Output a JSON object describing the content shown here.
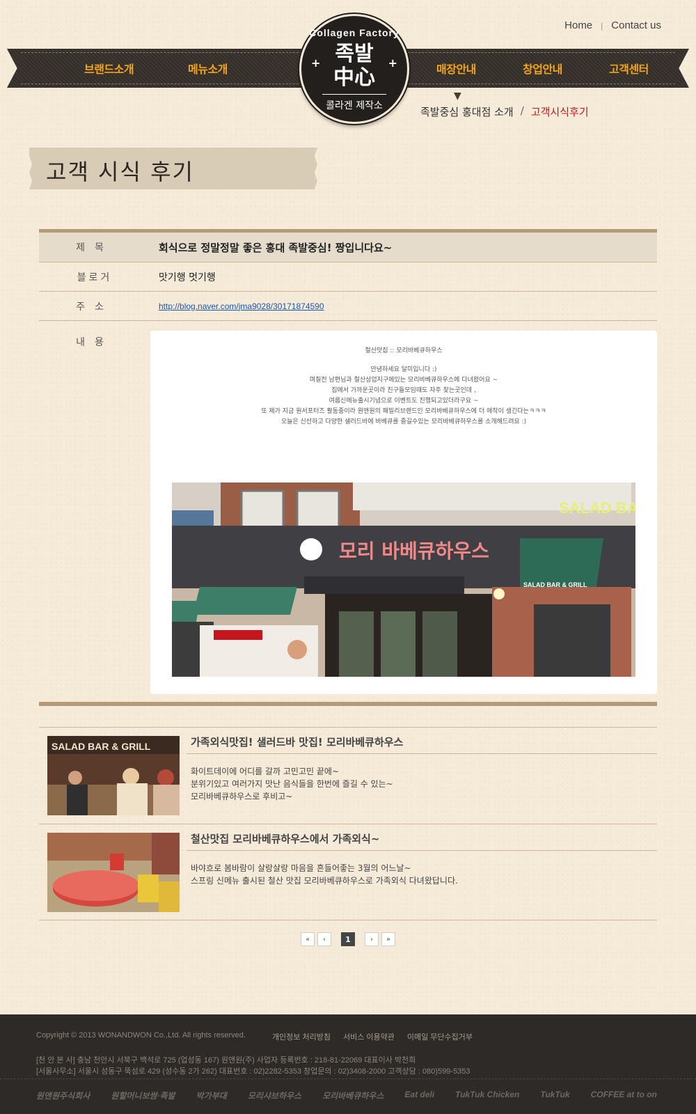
{
  "top_links": {
    "home": "Home",
    "contact": "Contact us"
  },
  "nav": [
    "브랜드소개",
    "메뉴소개",
    "매장안내",
    "창업안내",
    "고객센터"
  ],
  "logo": {
    "top": "Collagen Factory",
    "main_line1": "족발",
    "main_line2": "中心",
    "sub": "콜라겐 제작소"
  },
  "breadcrumb": {
    "parent": "족발중심 홍대점 소개",
    "sep": "/",
    "current": "고객시식후기"
  },
  "page_title": "고객 시식 후기",
  "detail": {
    "title_label": "제목",
    "title": "회식으로 정말정말 좋은 홍대 족발중심! 짱입니다요~",
    "blogger_label": "블로거",
    "blogger": "맛기행 멋기행",
    "address_label": "주소",
    "address": "http://blog.naver.com/jma9028/30171874590",
    "content_label": "내용",
    "content_heading": "철산맛집 :: 모리바베큐하우스",
    "content_lines": [
      "안녕하세요 달미입니다 :)",
      "며칠전 남편님과 철산상업지구에있는 모리바베큐하우스에 다녀왔어요 ~",
      "집에서 가까운곳이라 친구들모임때도 자주 찾는곳인데 ,",
      "여름신메뉴출시기념으로 이벤트도 진행되고있더라구요 ~",
      "또 제가 지금 원서포터즈 활동중이라 원앤원의 패밀리브랜드인 모리바베큐하우스에 더 애착이 생긴다는ㅋㅋㅋ",
      "오늘은 신선하고 다양한 샐러드바에 바베큐를 즐길수있는 모리바베큐하우스를 소개해드려요 :)"
    ],
    "photo": {
      "sign_korean": "모리 바베큐하우스",
      "salad_bar": "SALAD BA",
      "awning": "SALAD BAR & GRILL"
    }
  },
  "related": [
    {
      "title": "가족외식맛집! 샐러드바 맛집! 모리바베큐하우스",
      "thumb_sign": "SALAD BAR & GRILL",
      "desc": [
        "화이트데이에 어디를 갈까 고민고민 끝에~",
        "분위기있고 여러가지 맛난 음식들을 한번에 즐길 수 있는~",
        "모리바베큐하우스로 후비고~"
      ]
    },
    {
      "title": "철산맛집 모리바베큐하우스에서 가족외식~",
      "desc": [
        "바야흐로 봄바람이 살랑살랑 마음을 흔들어좋는 3월의 어느날~",
        "스프링 신메뉴 출시된 철산 맛집 모리바베큐하우스로 가족외식 다녀왔답니다."
      ]
    }
  ],
  "pagination": {
    "first": "«",
    "prev": "‹",
    "current": "1",
    "next": "›",
    "last": "»"
  },
  "footer": {
    "copyright": "Copyright © 2013 WONANDWON Co.,Ltd. All rights reserved.",
    "links": [
      "개인정보 처리방침",
      "서비스 이용약관",
      "이메일 무단수집거부"
    ],
    "addr1": "[천 안 본 사] 충남 천안시 서북구 백석로 725 (업성동 167) 원앤원(주) 사업자 등록번호 : 218-81-22069 대표이사 박천희",
    "addr2": "[서울사무소] 서울시 성동구 뚝섬로 429 (성수동 2가 262)    대표번호 : 02)2282-5353    창업문의 : 02)3408-2000    고객상담 : 080)599-5353",
    "brands": [
      "원앤원주식회사",
      "원할머니보쌈·족발",
      "박가부대",
      "모리샤브하우스",
      "모리바베큐하우스",
      "Eat deli",
      "TukTuk Chicken",
      "TukTuk",
      "COFFEE at to on"
    ]
  },
  "colors": {
    "nav_text": "#f3a519",
    "accent_red": "#c4161c",
    "band": "#b59a77",
    "footer_bg": "#2e2a27"
  }
}
